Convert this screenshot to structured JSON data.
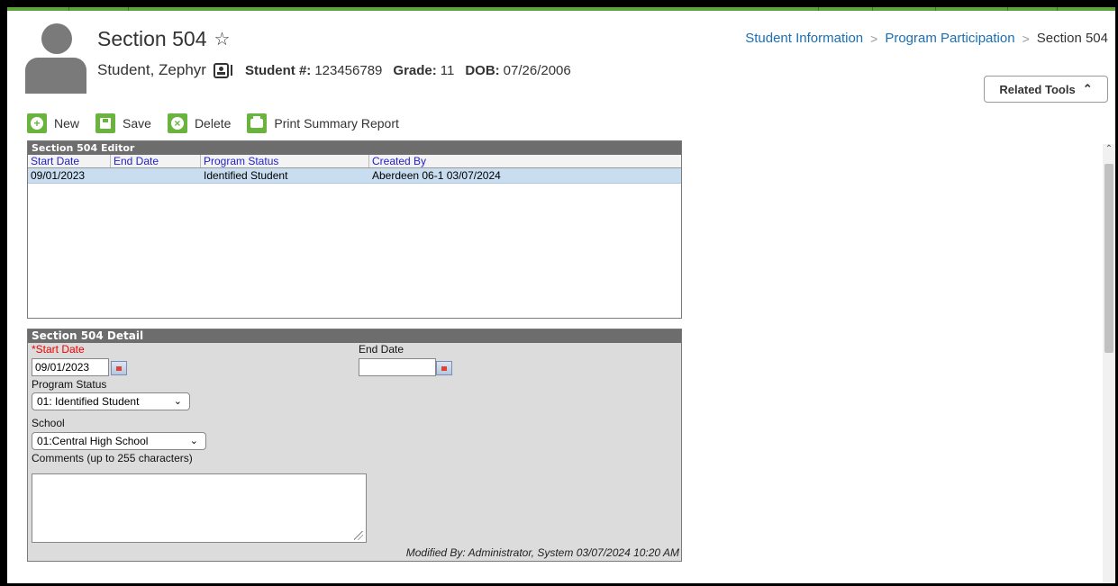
{
  "header": {
    "title": "Section 504",
    "student_name": "Student, Zephyr",
    "student_num_label": "Student #:",
    "student_num": "123456789",
    "grade_label": "Grade:",
    "grade": "11",
    "dob_label": "DOB:",
    "dob": "07/26/2006"
  },
  "breadcrumb": {
    "items": [
      "Student Information",
      "Program Participation",
      "Section 504"
    ]
  },
  "related_tools": {
    "label": "Related Tools",
    "icon": "chevron-up-icon"
  },
  "toolbar": {
    "new": "New",
    "save": "Save",
    "delete": "Delete",
    "print": "Print Summary Report"
  },
  "editor": {
    "title": "Section 504 Editor",
    "columns": [
      "Start Date",
      "End Date",
      "Program Status",
      "Created By"
    ],
    "rows": [
      {
        "start": "09/01/2023",
        "end": "",
        "status": "Identified Student",
        "created_by": "Aberdeen 06-1 03/07/2024"
      }
    ]
  },
  "detail": {
    "title": "Section 504 Detail",
    "start_date_label": "*Start Date",
    "start_date_value": "09/01/2023",
    "end_date_label": "End Date",
    "end_date_value": "",
    "program_status_label": "Program Status",
    "program_status_value": "01: Identified Student",
    "school_label": "School",
    "school_value": "01:Central High School",
    "comments_label": "Comments (up to 255 characters)",
    "comments_value": "",
    "modified_by": "Modified By: Administrator, System 03/07/2024 10:20 AM"
  },
  "colors": {
    "accent_green": "#6bb33f",
    "link_blue": "#1a6fb5",
    "panel_header": "#6d6d6d",
    "selected_row": "#c8def0",
    "required_red": "#ee0000"
  }
}
